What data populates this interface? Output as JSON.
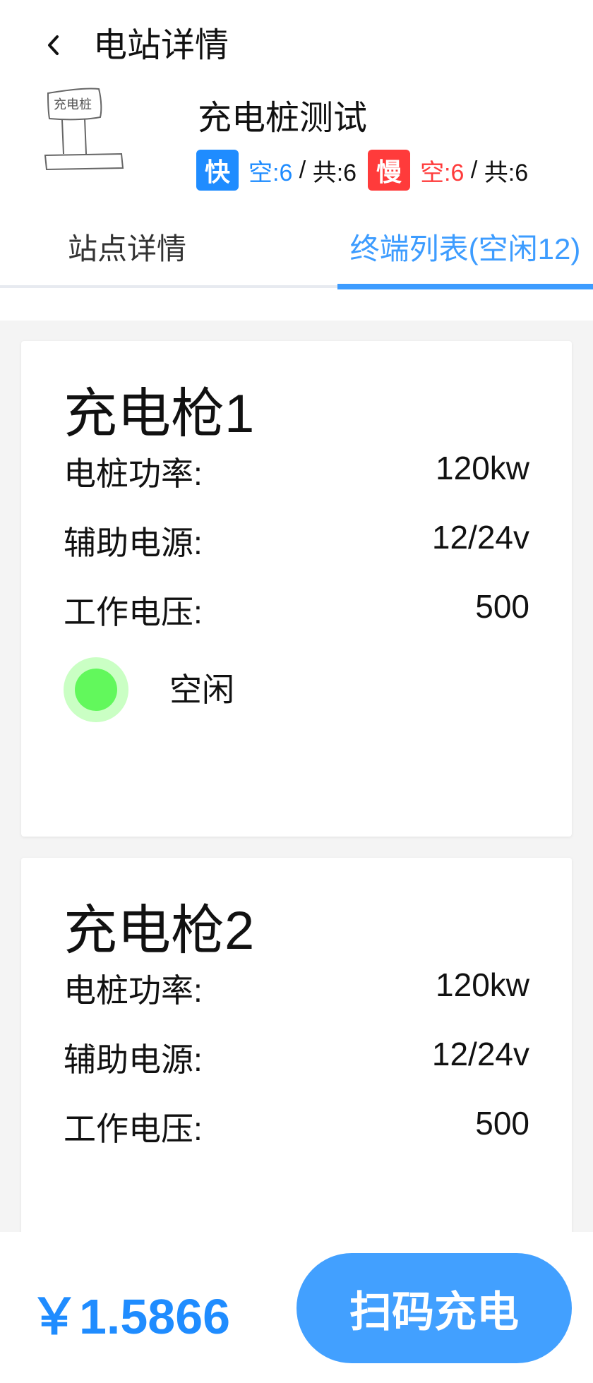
{
  "header": {
    "title": "电站详情"
  },
  "station": {
    "thumb_text": "充电桩",
    "name": "充电桩测试",
    "fast": {
      "badge": "快",
      "free": "空:6",
      "sep": " / ",
      "total": "共:6"
    },
    "slow": {
      "badge": "慢",
      "free": "空:6",
      "sep": " / ",
      "total": "共:6"
    }
  },
  "tabs": [
    {
      "label": "站点详情"
    },
    {
      "label": "终端列表(空闲12)"
    }
  ],
  "guns": [
    {
      "title": "充电枪1",
      "rows": [
        {
          "label": "电桩功率:",
          "value": "120kw"
        },
        {
          "label": "辅助电源:",
          "value": "12/24v"
        },
        {
          "label": "工作电压:",
          "value": "500"
        }
      ],
      "status": "空闲"
    },
    {
      "title": "充电枪2",
      "rows": [
        {
          "label": "电桩功率:",
          "value": "120kw"
        },
        {
          "label": "辅助电源:",
          "value": "12/24v"
        },
        {
          "label": "工作电压:",
          "value": "500"
        }
      ]
    }
  ],
  "footer": {
    "price": "￥1.5866",
    "button": "扫码充电"
  },
  "colors": {
    "accent": "#1f8cff",
    "slow": "#ff3b3b",
    "idle": "#62f85c"
  }
}
